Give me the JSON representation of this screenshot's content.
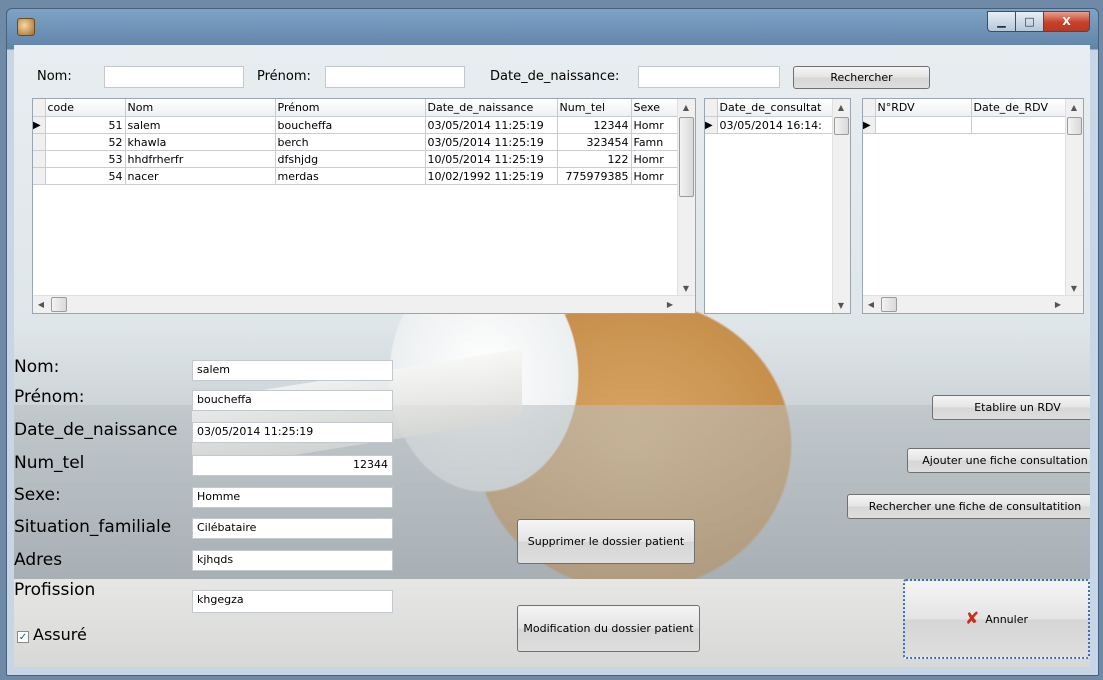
{
  "search": {
    "nom_label": "Nom:",
    "nom_value": "",
    "prenom_label": "Prénom:",
    "prenom_value": "",
    "dob_label": "Date_de_naissance:",
    "dob_value": "",
    "button": "Rechercher"
  },
  "patients": {
    "headers": [
      "code",
      "Nom",
      "Prénom",
      "Date_de_naissance",
      "Num_tel",
      "Sexe"
    ],
    "rows": [
      {
        "code": "51",
        "nom": "salem",
        "prenom": "boucheffa",
        "dob": "03/05/2014 11:25:19",
        "tel": "12344",
        "sexe": "Homr"
      },
      {
        "code": "52",
        "nom": "khawla",
        "prenom": "berch",
        "dob": "03/05/2014 11:25:19",
        "tel": "323454",
        "sexe": "Famn"
      },
      {
        "code": "53",
        "nom": "hhdfrherfr",
        "prenom": "dfshjdg",
        "dob": "10/05/2014 11:25:19",
        "tel": "122",
        "sexe": "Homr"
      },
      {
        "code": "54",
        "nom": "nacer",
        "prenom": "merdas",
        "dob": "10/02/1992 11:25:19",
        "tel": "775979385",
        "sexe": "Homr"
      }
    ]
  },
  "consultations": {
    "header": "Date_de_consultat",
    "rows": [
      "03/05/2014 16:14:"
    ]
  },
  "rdv": {
    "headers": [
      "N°RDV",
      "Date_de_RDV"
    ]
  },
  "form": {
    "nom_label": "Nom:",
    "nom": "salem",
    "prenom_label": "Prénom:",
    "prenom": "boucheffa",
    "dob_label": "Date_de_naissance",
    "dob": "03/05/2014 11:25:19",
    "tel_label": "Num_tel",
    "tel": "12344",
    "sexe_label": "Sexe:",
    "sexe": "Homme",
    "situation_label": "Situation_familiale",
    "situation": "Cilébataire",
    "adres_label": "Adres",
    "adres": "kjhqds",
    "profession_label": "Profission",
    "profession": "khgegza",
    "assure_label": "Assuré",
    "assure_checked": true
  },
  "actions": {
    "etablir_rdv": "Etablire un RDV",
    "ajouter_fiche": "Ajouter une fiche consultation",
    "rechercher_fiche": "Rechercher une fiche de consultatition",
    "supprimer": "Supprimer le dossier patient",
    "modifier": "Modification du dossier patient",
    "annuler": "Annuler"
  },
  "window": {
    "minimize": "▁",
    "maximize": "□",
    "close": "X"
  },
  "colors": {
    "close_red": "#c6412a",
    "annuler_x": "#c8311c",
    "checkbox_blue": "#2a4b83"
  }
}
